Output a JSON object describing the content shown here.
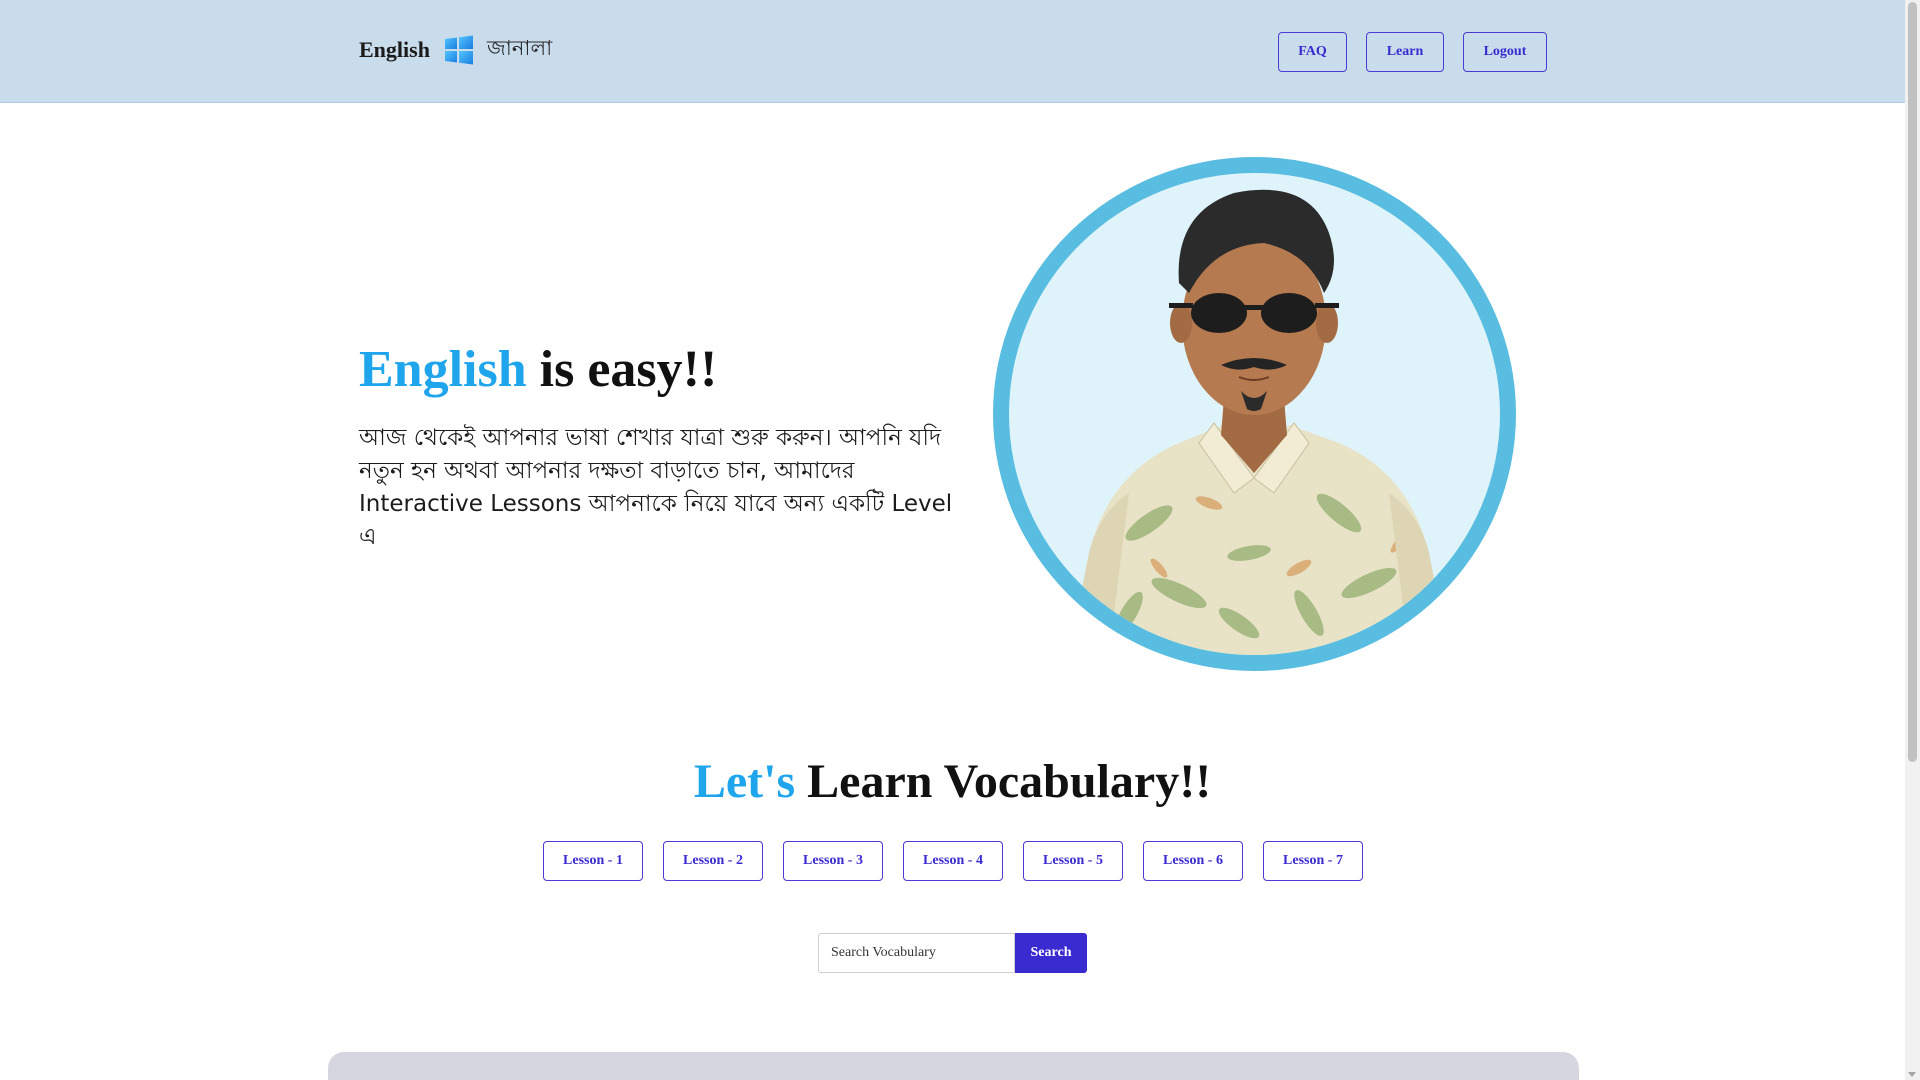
{
  "header": {
    "brand_text": "English",
    "brand_icon": "windows-logo-icon",
    "brand_sub": "জানালা",
    "nav": {
      "faq": "FAQ",
      "learn": "Learn",
      "logout": "Logout"
    }
  },
  "hero": {
    "title_accent": "English",
    "title_rest": " is easy!!",
    "description": "আজ থেকেই আপনার ভাষা শেখার যাত্রা শুরু করুন। আপনি যদি নতুন হন অথবা আপনার দক্ষতা বাড়াতে চান, আমাদের Interactive Lessons আপনাকে নিয়ে যাবে অন্য একটি Level এ",
    "avatar": "man-in-sunglasses-illustration"
  },
  "vocabulary": {
    "title_accent": "Let's",
    "title_rest": " Learn Vocabulary!!",
    "lessons": [
      "Lesson - 1",
      "Lesson - 2",
      "Lesson - 3",
      "Lesson - 4",
      "Lesson - 5",
      "Lesson - 6",
      "Lesson - 7"
    ]
  },
  "search": {
    "placeholder": "Search Vocabulary",
    "button": "Search"
  },
  "colors": {
    "accent": "#1ea5ec",
    "primary": "#3a2bd0",
    "navbar_bg": "#c9dcec"
  }
}
